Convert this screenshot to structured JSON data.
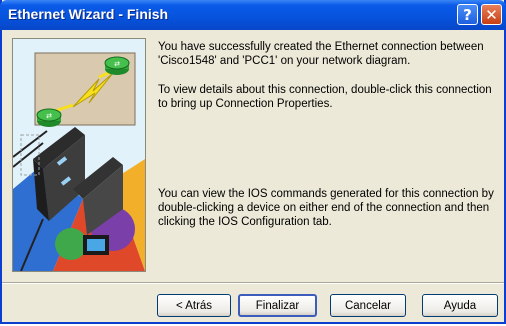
{
  "window": {
    "title": "Ethernet Wizard - Finish",
    "help_glyph": "?",
    "close_glyph": "✕"
  },
  "content": {
    "paragraph_1": "You have successfully created the Ethernet connection between 'Cisco1548' and 'PCC1' on your network diagram.",
    "paragraph_2": "To view details about this connection, double-click this connection to bring up Connection Properties.",
    "paragraph_3": "You can view the IOS commands generated for this connection by double-clicking a device on either end of the connection  and then clicking the IOS Configuration tab."
  },
  "buttons": {
    "back": "< Atrás",
    "finish": "Finalizar",
    "cancel": "Cancelar",
    "help": "Ayuda"
  },
  "colors": {
    "titlebar": "#0653dc",
    "dialog_bg": "#ece9d8",
    "close_button": "#c73f13",
    "router_green": "#2fa836",
    "link_yellow": "#f7e01b"
  },
  "icons": {
    "side_image": "network-wizard-illustration",
    "router": "router-icon",
    "link": "lightning-link-icon"
  }
}
